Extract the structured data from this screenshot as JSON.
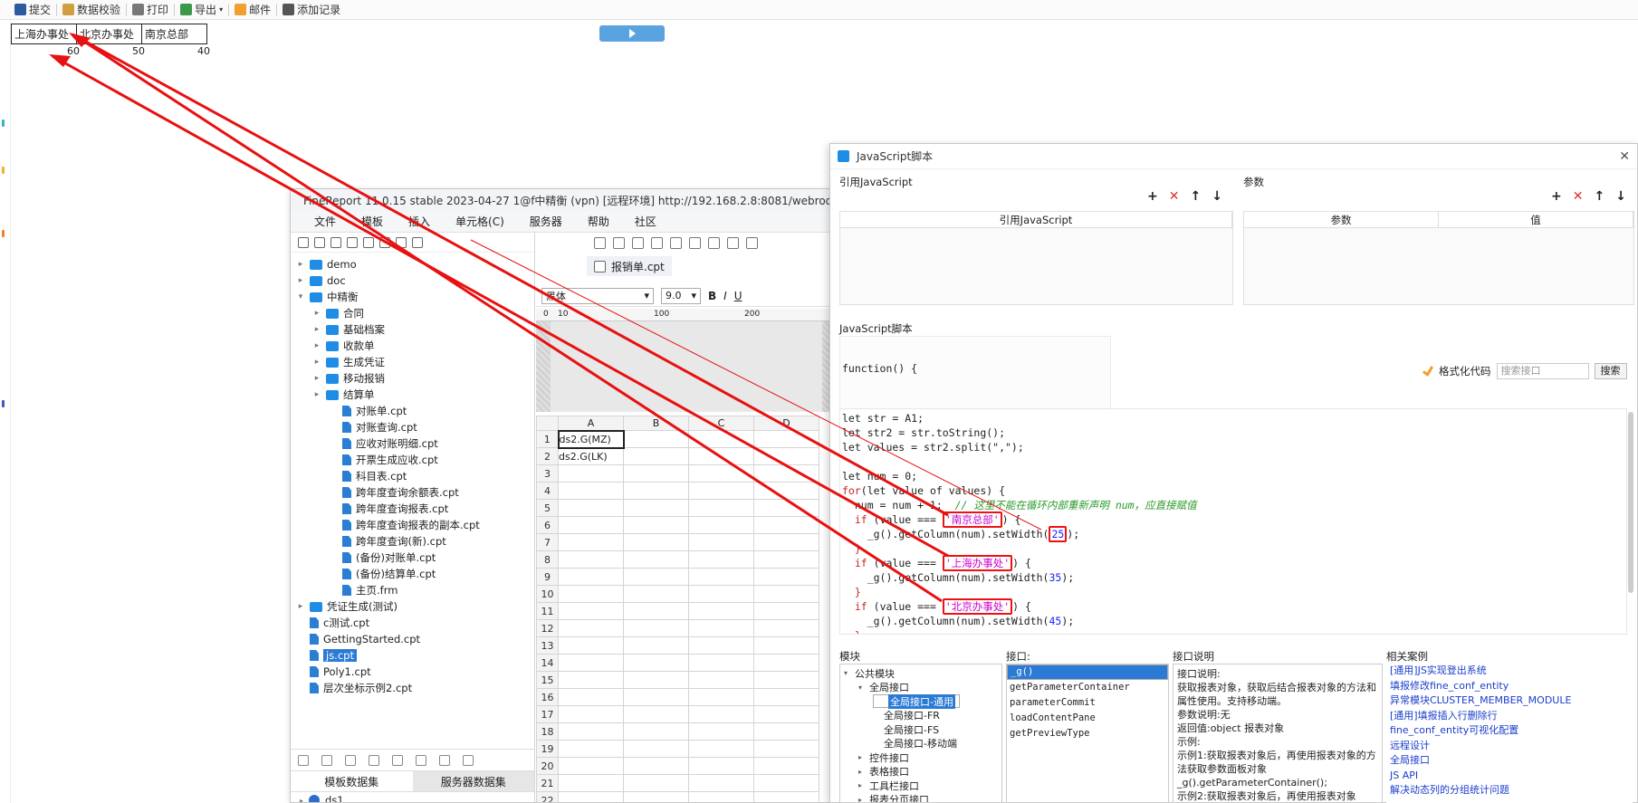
{
  "toolbar": {
    "submit": "提交",
    "validate": "数据校验",
    "print": "打印",
    "export": "导出",
    "mail": "邮件",
    "add_record": "添加记录"
  },
  "report": {
    "headers": [
      "上海办事处",
      "北京办事处",
      "南京总部"
    ],
    "values": [
      "60",
      "50",
      "40"
    ]
  },
  "designer": {
    "title": "FineReport 11.0.15 stable 2023-04-27 1@f中精衡 (vpn) [远程环境]  http://192.168.2.8:8081/webroot",
    "menu": [
      "文件",
      "模板",
      "插入",
      "单元格(C)",
      "服务器",
      "帮助",
      "社区"
    ],
    "tree": [
      {
        "label": "demo",
        "type": "folder",
        "level": 0,
        "arrow": "▸"
      },
      {
        "label": "doc",
        "type": "folder",
        "level": 0,
        "arrow": "▸"
      },
      {
        "label": "中精衡",
        "type": "folder",
        "level": 0,
        "arrow": "▾"
      },
      {
        "label": "合同",
        "type": "folder",
        "level": 1,
        "arrow": "▸"
      },
      {
        "label": "基础档案",
        "type": "folder",
        "level": 1,
        "arrow": "▸"
      },
      {
        "label": "收款单",
        "type": "folder",
        "level": 1,
        "arrow": "▸"
      },
      {
        "label": "生成凭证",
        "type": "folder",
        "level": 1,
        "arrow": "▸"
      },
      {
        "label": "移动报销",
        "type": "folder",
        "level": 1,
        "arrow": "▸"
      },
      {
        "label": "结算单",
        "type": "folder",
        "level": 1,
        "arrow": "▸"
      },
      {
        "label": "对账单.cpt",
        "type": "file",
        "level": 2,
        "arrow": ""
      },
      {
        "label": "对账查询.cpt",
        "type": "file",
        "level": 2,
        "arrow": ""
      },
      {
        "label": "应收对账明细.cpt",
        "type": "file",
        "level": 2,
        "arrow": ""
      },
      {
        "label": "开票生成应收.cpt",
        "type": "file",
        "level": 2,
        "arrow": ""
      },
      {
        "label": "科目表.cpt",
        "type": "file",
        "level": 2,
        "arrow": ""
      },
      {
        "label": "跨年度查询余额表.cpt",
        "type": "file",
        "level": 2,
        "arrow": ""
      },
      {
        "label": "跨年度查询报表.cpt",
        "type": "file",
        "level": 2,
        "arrow": ""
      },
      {
        "label": "跨年度查询报表的副本.cpt",
        "type": "file",
        "level": 2,
        "arrow": ""
      },
      {
        "label": "跨年度查询(新).cpt",
        "type": "file",
        "level": 2,
        "arrow": ""
      },
      {
        "label": "(备份)对账单.cpt",
        "type": "file",
        "level": 2,
        "arrow": ""
      },
      {
        "label": "(备份)结算单.cpt",
        "type": "file",
        "level": 2,
        "arrow": ""
      },
      {
        "label": "主页.frm",
        "type": "file",
        "level": 2,
        "arrow": ""
      },
      {
        "label": "凭证生成(测试)",
        "type": "folder",
        "level": 0,
        "arrow": "▸"
      },
      {
        "label": "c测试.cpt",
        "type": "file",
        "level": 0,
        "arrow": ""
      },
      {
        "label": "GettingStarted.cpt",
        "type": "file",
        "level": 0,
        "arrow": ""
      },
      {
        "label": "js.cpt",
        "type": "file",
        "level": 0,
        "arrow": "",
        "selected": true
      },
      {
        "label": "Poly1.cpt",
        "type": "file",
        "level": 0,
        "arrow": ""
      },
      {
        "label": "层次坐标示例2.cpt",
        "type": "file",
        "level": 0,
        "arrow": ""
      }
    ],
    "ds_tabs": [
      "模板数据集",
      "服务器数据集"
    ],
    "datasets": [
      "ds1",
      "ds2"
    ],
    "doc_tab": "报销单.cpt",
    "font_name": "黑体",
    "font_size": "9.0",
    "ruler": [
      "0",
      "10",
      "100",
      "200"
    ],
    "grid_cols": [
      "A",
      "B",
      "C",
      "D"
    ],
    "grid_rows": [
      "1",
      "2",
      "3",
      "4",
      "5",
      "6",
      "7",
      "8",
      "9",
      "10",
      "11",
      "12",
      "13",
      "14",
      "15",
      "16",
      "17",
      "18",
      "19",
      "20",
      "21",
      "22"
    ],
    "cell_a1": "ds2.G(MZ)",
    "cell_a2": "ds2.G(LK)"
  },
  "jsdialog": {
    "title": "JavaScript脚本",
    "ref_label": "引用JavaScript",
    "param_label": "参数",
    "ref_col": "引用JavaScript",
    "param_cols": [
      "参数",
      "值"
    ],
    "script_label": "JavaScript脚本",
    "fn_header": "function() {",
    "format_code": "格式化代码",
    "search_placeholder": "搜索接口",
    "search_btn": "搜索",
    "module_label": "模块",
    "iface_label": "接口:",
    "desc_label": "接口说明",
    "cases_label": "相关案例",
    "modules": [
      {
        "label": "公共模块",
        "level": 0,
        "arrow": "▾"
      },
      {
        "label": "全局接口",
        "level": 1,
        "arrow": "▾"
      },
      {
        "label": "全局接口-通用",
        "level": 2,
        "arrow": "",
        "selected": true
      },
      {
        "label": "全局接口-FR",
        "level": 2,
        "arrow": ""
      },
      {
        "label": "全局接口-FS",
        "level": 2,
        "arrow": ""
      },
      {
        "label": "全局接口-移动端",
        "level": 2,
        "arrow": ""
      },
      {
        "label": "控件接口",
        "level": 1,
        "arrow": "▸"
      },
      {
        "label": "表格接口",
        "level": 1,
        "arrow": "▸"
      },
      {
        "label": "工具栏接口",
        "level": 1,
        "arrow": "▸"
      },
      {
        "label": "报表分页接口",
        "level": 1,
        "arrow": "▸"
      }
    ],
    "interfaces": [
      "_g()",
      "getParameterContainer",
      "parameterCommit",
      "loadContentPane",
      "getPreviewType"
    ],
    "description": [
      "接口说明:",
      "获取报表对象，获取后结合报表对象的方法和属性使用。支持移动端。",
      "参数说明:无",
      "返回值:object 报表对象",
      "示例:",
      "示例1:获取报表对象后，再使用报表对象的方法获取参数面板对象",
      "_g().getParameterContainer();",
      "示例2:获取报表对象后，再使用报表对象"
    ],
    "cases": [
      "[通用]JS实现登出系统",
      "填报修改fine_conf_entity",
      "异常模块CLUSTER_MEMBER_MODULE",
      "[通用]填报插入行删除行",
      "fine_conf_entity可视化配置",
      "远程设计",
      "全局接口",
      "JS API",
      "解决动态列的分组统计问题"
    ]
  },
  "code": {
    "l1": "let str = A1;",
    "l2": "let str2 = str.toString();",
    "l3": "let values = str2.split(\",\");",
    "l5": "let num = 0;",
    "for_kw": "for",
    "for_rest": "(let value of values) {",
    "num_line": "  num = num + 1;",
    "comment": "  // 这里不能在循环内部重新声明 num，应直接赋值",
    "if_kw": "if",
    "cond": " (value === ",
    "s1": "'南京总部'",
    "s2": "'上海办事处'",
    "s3": "'北京办事处'",
    "close_paren": ") {",
    "call": "    _g().getColumn(num).setWidth(",
    "w1": "25",
    "w2": "35",
    "w3": "45",
    "call_end": ");",
    "brace": "  }",
    "end_brace": "}"
  },
  "colors": {
    "accent_red": "#e11111",
    "selection_blue": "#2b7bd6"
  }
}
